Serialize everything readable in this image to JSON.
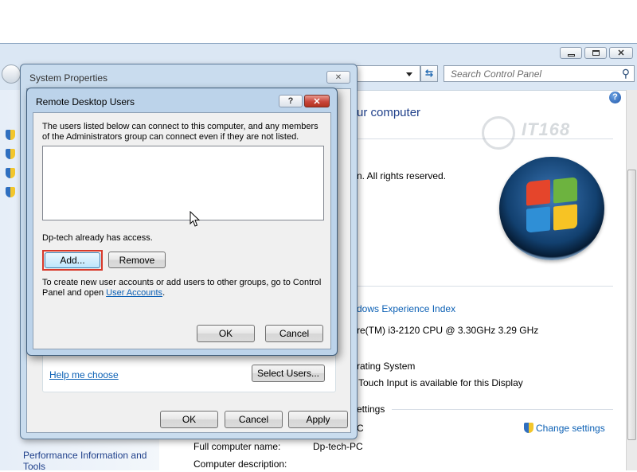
{
  "control_panel": {
    "search_placeholder": "Search Control Panel",
    "heading_fragment": "ur computer",
    "copyright_fragment": "n.  All rights reserved.",
    "wei_link_fragment": "dows Experience Index",
    "processor_fragment": "re(TM) i3-2120 CPU @ 3.30GHz   3.29 GHz",
    "os_fragment": "rating System",
    "pen_touch": "Touch Input is available for this Display",
    "settings_fragment": "ettings",
    "change_settings": "Change settings",
    "full_computer_name_label": "Full computer name:",
    "full_computer_name_value": "Dp-tech-PC",
    "full_computer_name_partial": "C",
    "computer_description_label": "Computer description:",
    "perf_link": "Performance Information and Tools",
    "watermark": "IT168"
  },
  "system_properties": {
    "title": "System Properties",
    "help_me_choose": "Help me choose",
    "select_users": "Select Users...",
    "ok": "OK",
    "cancel": "Cancel",
    "apply": "Apply"
  },
  "remote_desktop_users": {
    "title": "Remote Desktop Users",
    "description": "The users listed below can connect to this computer, and any members of the Administrators group can connect even if they are not listed.",
    "users": [],
    "access_note": "Dp-tech already has access.",
    "add": "Add...",
    "remove": "Remove",
    "footer_text": "To create new user accounts or add users to other groups, go to Control Panel and open",
    "user_accounts_link": "User Accounts",
    "period": ".",
    "ok": "OK",
    "cancel": "Cancel"
  },
  "colors": {
    "aero_frame": "#c9dcee",
    "dialog_face": "#f0f0f0",
    "link": "#0a5fb4",
    "close_red": "#c8453b",
    "highlight": "#d8392b"
  }
}
